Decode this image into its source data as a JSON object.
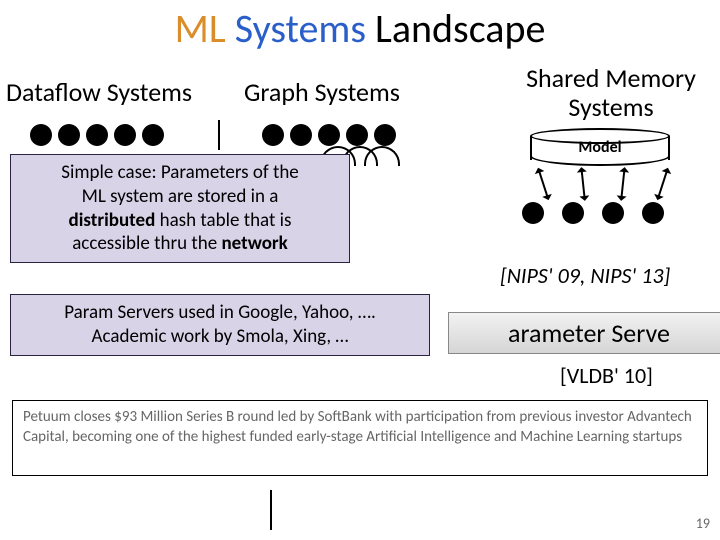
{
  "title": {
    "w1": "ML",
    "w2": "Systems",
    "w3": "Landscape"
  },
  "columns": {
    "dataflow": "Dataflow Systems",
    "graph": "Graph Systems",
    "shared": "Shared Memory\nSystems"
  },
  "model_label": "Model",
  "callouts": {
    "c1_l1": "Simple case: Parameters of the",
    "c1_l2": "ML system are stored in a",
    "c1_l3": "distributed hash table that is",
    "c1_l4": "accessible thru the network",
    "c2_l1": "Param Servers used in Google, Yahoo, ….",
    "c2_l2": "Academic work by Smola, Xing, …"
  },
  "citations": {
    "nips": "[NIPS' 09, NIPS' 13]",
    "vldb": "[VLDB' 10]"
  },
  "partial_box": "arameter Serve",
  "news": "Petuum closes $93 Million Series B round led by SoftBank with participation from previous investor Advantech Capital, becoming one of the highest funded early-stage Artificial Intelligence and Machine Learning startups",
  "page": "19"
}
